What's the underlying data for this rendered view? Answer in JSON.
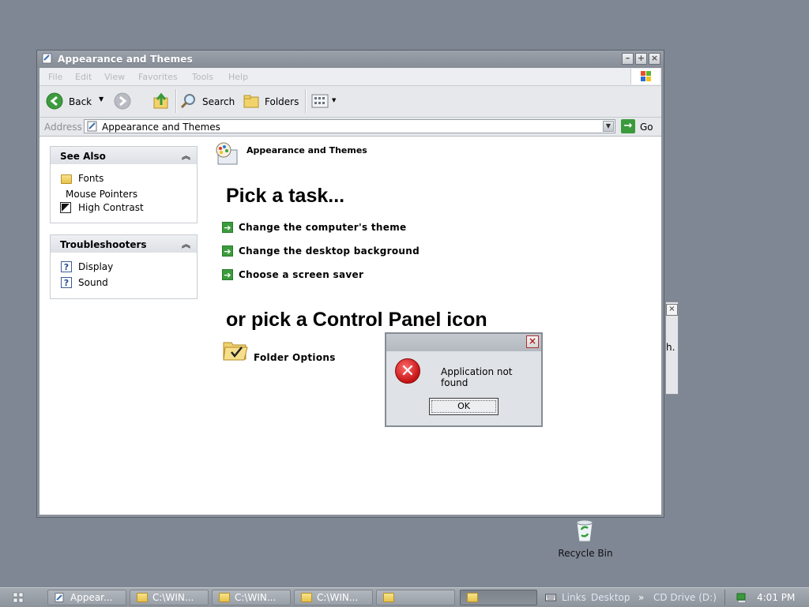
{
  "window": {
    "title": "Appearance and Themes",
    "controls": {
      "minimize": "–",
      "maximize": "+",
      "close": "×"
    }
  },
  "menu": [
    "File",
    "Edit",
    "View",
    "Favorites",
    "Tools",
    "Help"
  ],
  "toolbar": {
    "back": "Back",
    "search": "Search",
    "folders": "Folders"
  },
  "address": {
    "label": "Address",
    "value": "Appearance and Themes",
    "go": "Go"
  },
  "see_also": {
    "title": "See Also",
    "items": [
      "Fonts",
      "Mouse Pointers",
      "High Contrast"
    ]
  },
  "troubleshooters": {
    "title": "Troubleshooters",
    "items": [
      "Display",
      "Sound"
    ]
  },
  "main": {
    "category_title": "Appearance and Themes",
    "pick_task": "Pick a task...",
    "tasks": [
      "Change the computer's theme",
      "Change the desktop background",
      "Choose a screen saver"
    ],
    "pick_icon": "or pick a Control Panel icon",
    "icons": [
      "Folder Options"
    ]
  },
  "dialog": {
    "close": "×",
    "message": "Application not found",
    "ok": "OK"
  },
  "background_window": {
    "close": "×",
    "fragment": "h."
  },
  "desktop": {
    "recycle_bin": "Recycle Bin"
  },
  "taskbar": {
    "buttons": [
      "Appear...",
      "C:\\WIN...",
      "C:\\WIN...",
      "C:\\WIN...",
      "",
      ""
    ],
    "links": "Links",
    "desktop_link": "Desktop",
    "drive": "CD Drive (D:)",
    "clock": "4:01 PM"
  }
}
